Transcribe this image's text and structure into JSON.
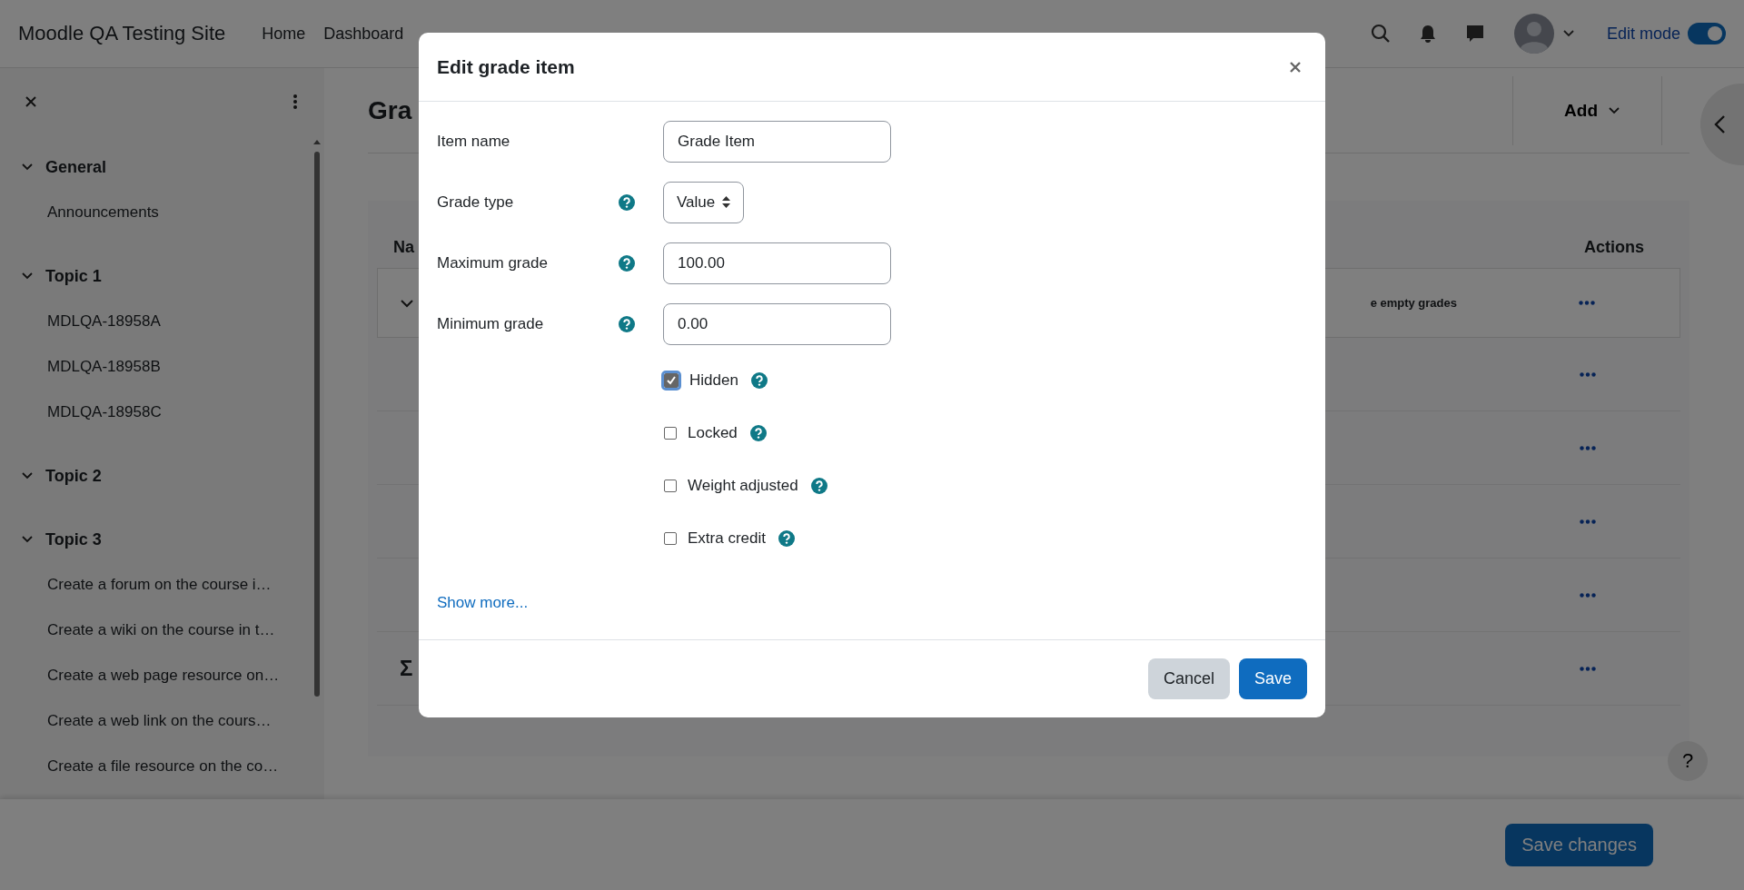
{
  "navbar": {
    "site_name": "Moodle QA Testing Site",
    "links": [
      "Home",
      "Dashboard"
    ],
    "edit_mode": {
      "label": "Edit mode",
      "on": true
    }
  },
  "sidebar": {
    "sections": [
      {
        "title": "General",
        "expanded": true,
        "children": [
          "Announcements"
        ]
      },
      {
        "title": "Topic 1",
        "expanded": true,
        "children": [
          "MDLQA-18958A",
          "MDLQA-18958B",
          "MDLQA-18958C"
        ]
      },
      {
        "title": "Topic 2",
        "expanded": true
      },
      {
        "title": "Topic 3",
        "expanded": true,
        "children": [
          "Create a forum on the course i…",
          "Create a wiki on the course in t…",
          "Create a web page resource on…",
          "Create a web link on the cours…",
          "Create a file resource on the co…"
        ]
      }
    ]
  },
  "page": {
    "title": "Gra",
    "add_button": "Add",
    "table": {
      "name_header": "Na",
      "actions_header": "Actions",
      "rows": [
        {
          "kind": "category",
          "text": "e empty grades"
        },
        {
          "kind": "item"
        },
        {
          "kind": "item"
        },
        {
          "kind": "item"
        },
        {
          "kind": "item"
        },
        {
          "kind": "total",
          "text": "Σ"
        }
      ]
    }
  },
  "help_button": "?",
  "footer": {
    "save_button": "Save changes"
  },
  "modal": {
    "title": "Edit grade item",
    "fields": [
      {
        "kind": "text",
        "label": "Item name",
        "help": false,
        "value": "Grade Item"
      },
      {
        "kind": "select",
        "label": "Grade type",
        "help": true,
        "value": "Value"
      },
      {
        "kind": "text",
        "label": "Maximum grade",
        "help": true,
        "value": "100.00"
      },
      {
        "kind": "text",
        "label": "Minimum grade",
        "help": true,
        "value": "0.00"
      }
    ],
    "checkboxes": [
      {
        "label": "Hidden",
        "checked": true,
        "help": true
      },
      {
        "label": "Locked",
        "checked": false,
        "help": true
      },
      {
        "label": "Weight adjusted",
        "checked": false,
        "help": true
      },
      {
        "label": "Extra credit",
        "checked": false,
        "help": true
      }
    ],
    "show_more": "Show more...",
    "buttons": [
      {
        "label": "Cancel",
        "kind": "secondary"
      },
      {
        "label": "Save",
        "kind": "primary"
      }
    ]
  }
}
